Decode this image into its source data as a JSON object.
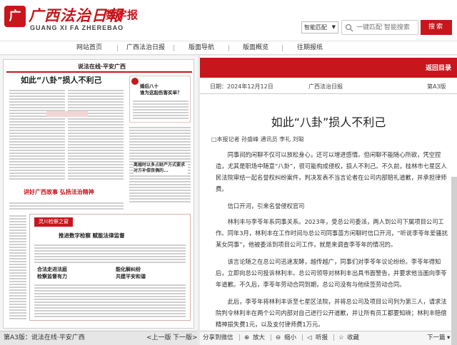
{
  "header": {
    "logo_mark": "广",
    "logo_cn": "广西法治日報",
    "logo_en": "GUANG XI FA ZHEREBAO",
    "logo_sub": "数字报",
    "search_mode": "智能匹配",
    "search_placeholder": "一键匹配 智能搜索",
    "search_button": "搜索"
  },
  "nav": [
    "网站首页",
    "广西法治日报",
    "版面导航",
    "版面概览",
    "往期报纸"
  ],
  "thumb": {
    "masthead": "说法在线·平安广西",
    "headline": "如此“八卦”损人不利己",
    "side_headline": "婚后八十\n谁为这起伤害买单？",
    "side_block_title": "离婚时以多占财产方式要求对方补偿丧偶的...",
    "banner_text": "讲好广西故事 弘扬法治精神",
    "bottom_tag": "灵川检察之窗",
    "bottom_sub": "推进数字检察 赋能法律监督",
    "col1": "合法走进法庭\n检察监督有力",
    "col2": "能化解纠纷\n共建平安和谐"
  },
  "left_bar": {
    "label": "第A3版：说法在线·平安广西",
    "prev": "<上一版",
    "next": "下一版>"
  },
  "article_bar": {
    "back": "返回目录"
  },
  "meta": {
    "date": "日期：2024年12月12日",
    "paper": "广西法治日报",
    "page": "第A3版"
  },
  "article": {
    "title": "如此“八卦”损人不利己",
    "reporter": "□本报记者 孙盛峰 通讯员 李礼 刘聪",
    "paragraphs": [
      "同事间的闲聊不仅可以放松身心，还可以增进感情。但闲聊不能随心所欲，凭空捏造，尤其是职场中随意“八卦”，很可能构成侵权，损人不利己。不久前，桂林市七星区人民法院审结一起名誉权纠纷案件，判决发表不当言论者在公司内部赔礼道歉，并承担律师费。",
      "信口开河，引来名誉侵权官司",
      "林利丰与李苓年系同事关系。2023年，受总公司委派，两人到公司下属项目公司工作。同年3月，林利丰在工作时间与总公司同事苗方闲聊时信口开河，“听说李苓年爱骚扰某女同事”，他被委派到项目公司工作，就是来调查李苓年的情况的。",
      "该言论随之在总公司迅速发酵，越传越广，同事们对李苓年议论纷纷。李苓年得知后，立即向总公司投诉林利丰。总公司领导对林利丰出具书面警告，并要求他当面向李苓年道歉。不久后，李苓年劳动合同到期，总公司没有与他续签劳动合同。",
      "此后，李苓年将林利丰诉至七星区法院，并将总公司及项目公司列为第三人，请求法院判令林利丰在两个公司内部对自己进行公开道歉，并让所有员工都要知晓；林利丰赔偿精神损失费1元，以及支付律师费1万元。"
    ]
  },
  "article_footer": {
    "share": "分享到微信",
    "zoom_in": "放大",
    "zoom_out": "缩小",
    "listen": "听报",
    "collect": "收藏",
    "next": "下一篇"
  },
  "colors": {
    "brand": "#c8161d"
  }
}
